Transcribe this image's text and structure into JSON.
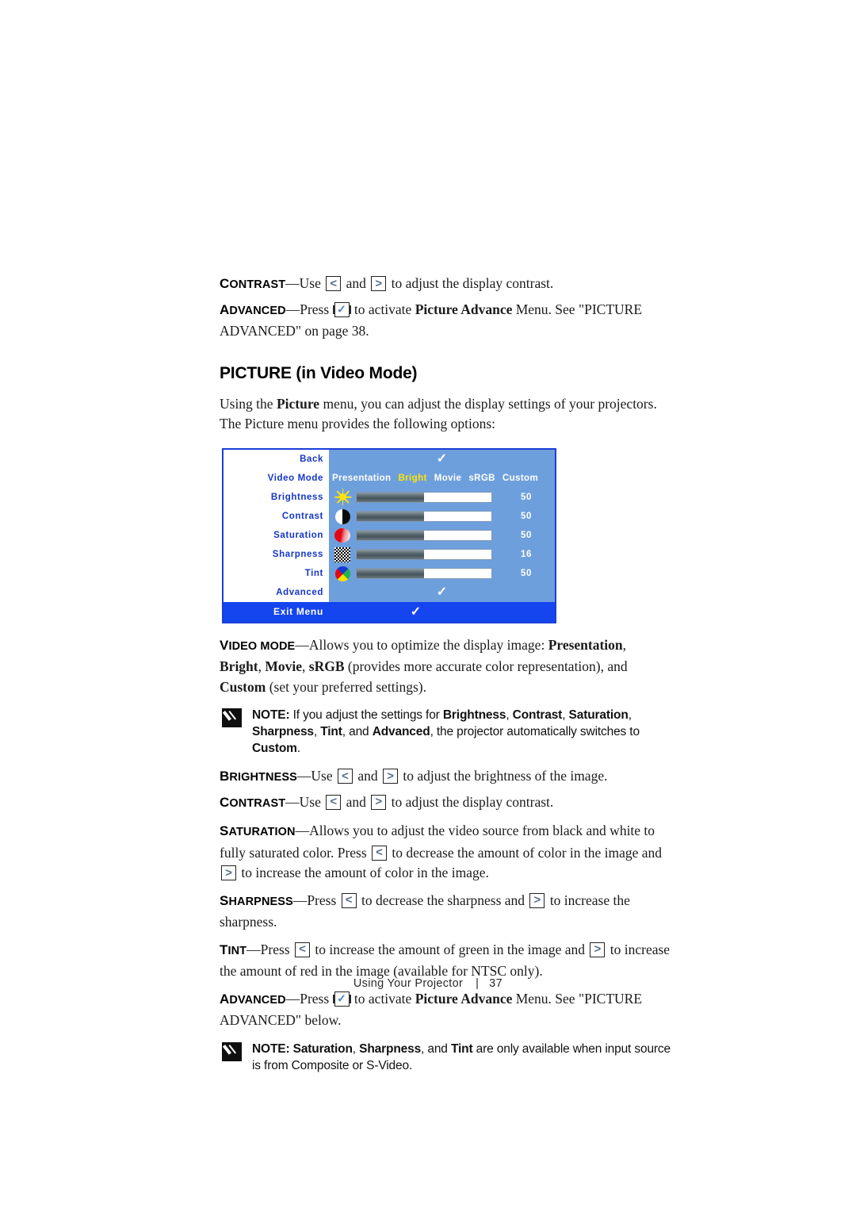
{
  "page": {
    "footer_section": "Using Your Projector",
    "footer_separator": "|",
    "footer_page_number": "37"
  },
  "intro": {
    "contrast_term": "C",
    "contrast_term_rest": "ONTRAST",
    "contrast_text_1": "—Use",
    "contrast_text_2": "and",
    "contrast_text_3": "to adjust the display contrast.",
    "advanced_term": "A",
    "advanced_term_rest": "DVANCED",
    "advanced_text_1": "—Press",
    "advanced_text_2": "to activate",
    "advanced_bold_1": "Picture Advance",
    "advanced_text_3": "Menu. See \"PICTURE ADVANCED\" on page 38."
  },
  "heading": "PICTURE (in Video Mode)",
  "lead_paragraph": {
    "text_1": "Using the",
    "bold_1": "Picture",
    "text_2": "menu, you can adjust the display settings of your projectors. The Picture menu provides the following options:"
  },
  "osd": {
    "rows": [
      {
        "label": "Back",
        "type": "check"
      },
      {
        "label": "Video Mode",
        "type": "modes"
      },
      {
        "label": "Brightness",
        "type": "slider",
        "icon": "sun-icon",
        "value": "50",
        "fill_percent": 50
      },
      {
        "label": "Contrast",
        "type": "slider",
        "icon": "contrast-icon",
        "value": "50",
        "fill_percent": 50
      },
      {
        "label": "Saturation",
        "type": "slider",
        "icon": "saturation-icon",
        "value": "50",
        "fill_percent": 50
      },
      {
        "label": "Sharpness",
        "type": "slider",
        "icon": "sharpness-icon",
        "value": "16",
        "fill_percent": 50
      },
      {
        "label": "Tint",
        "type": "slider",
        "icon": "tint-icon",
        "value": "50",
        "fill_percent": 50
      },
      {
        "label": "Advanced",
        "type": "check"
      }
    ],
    "video_modes": [
      {
        "label": "Presentation",
        "selected": false
      },
      {
        "label": "Bright",
        "selected": true
      },
      {
        "label": "Movie",
        "selected": false
      },
      {
        "label": "sRGB",
        "selected": false
      },
      {
        "label": "Custom",
        "selected": false
      }
    ],
    "exit_label": "Exit Menu",
    "check_glyph": "✓",
    "colors": {
      "border": "#1a3fd8",
      "panel_background": "#6e9fdd",
      "label_background": "#ffffff",
      "label_text": "#1437c8",
      "selected_mode_text": "#ffe500",
      "exit_bar": "#1545ee",
      "slider_track": "#ffffff"
    }
  },
  "body": {
    "video_mode": {
      "term_cap": "V",
      "term_rest": "IDEO MODE",
      "text_1": "—Allows you to optimize the display image:",
      "bold_1": "Presentation",
      "sep_1": ",",
      "bold_2": "Bright",
      "sep_2": ",",
      "bold_3": "Movie",
      "sep_3": ",",
      "bold_4": "sRGB",
      "text_2": "(provides more accurate color representation), and",
      "bold_5": "Custom",
      "text_3": "(set your preferred settings)."
    },
    "note_1": {
      "label": "NOTE:",
      "text_1": "If you adjust the settings for",
      "bold_1": "Brightness",
      "bold_2": "Contrast",
      "bold_3": "Saturation",
      "bold_4": "Sharpness",
      "bold_5": "Tint",
      "text_2": "and",
      "bold_6": "Advanced",
      "text_3": ", the projector automatically switches to",
      "bold_7": "Custom",
      "text_4": "."
    },
    "brightness": {
      "term_cap": "B",
      "term_rest": "RIGHTNESS",
      "text_1": "—Use",
      "text_2": "and",
      "text_3": "to adjust the brightness of the image."
    },
    "contrast": {
      "term_cap": "C",
      "term_rest": "ONTRAST",
      "text_1": "—Use",
      "text_2": "and",
      "text_3": "to adjust the display contrast."
    },
    "saturation": {
      "term_cap": "S",
      "term_rest": "ATURATION",
      "text_1": "—Allows you to adjust the video source from black and white to fully saturated color. Press",
      "text_2": "to decrease the amount of color in the image and",
      "text_3": "to increase the amount of color in the image."
    },
    "sharpness": {
      "term_cap": "S",
      "term_rest": "HARPNESS",
      "text_1": "—Press",
      "text_2": "to decrease the sharpness and",
      "text_3": "to increase the sharpness."
    },
    "tint": {
      "term_cap": "T",
      "term_rest": "INT",
      "text_1": "—Press",
      "text_2": "to increase the amount of green in the image and",
      "text_3": "to increase the amount of red in the image (available for NTSC only)."
    },
    "advanced": {
      "term_cap": "A",
      "term_rest": "DVANCED",
      "text_1": "—Press",
      "text_2": "to activate",
      "bold_1": "Picture Advance",
      "text_3": "Menu. See \"PICTURE ADVANCED\" below."
    },
    "note_2": {
      "label": "NOTE:",
      "bold_1": "Saturation",
      "sep_1": ",",
      "bold_2": "Sharpness",
      "text_1": ", and",
      "bold_3": "Tint",
      "text_2": "are only available when input source is from Composite or S-Video."
    }
  },
  "icons": {
    "left_arrow": "◁",
    "right_arrow": "▷",
    "left_glyph": "<",
    "right_glyph": ">",
    "check_glyph": "✓"
  }
}
